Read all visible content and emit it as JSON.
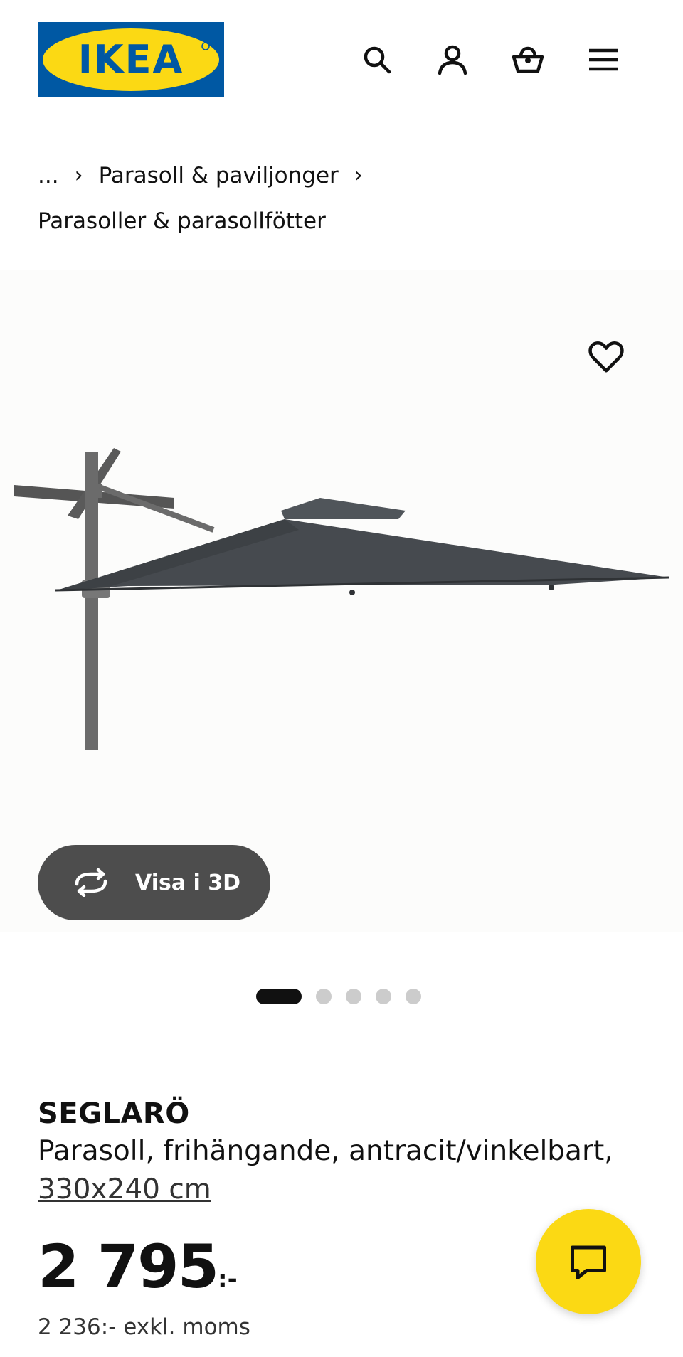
{
  "header": {
    "logo_text": "IKEA",
    "icons": [
      "search-icon",
      "profile-icon",
      "cart-icon",
      "menu-icon"
    ]
  },
  "breadcrumb": {
    "ellipsis": "...",
    "items": [
      "Parasoll & paviljonger",
      "Parasoller & parasollfötter"
    ],
    "separator": "›"
  },
  "media": {
    "view3d_label": "Visa i 3D",
    "dots_total": 5,
    "active_index": 0
  },
  "product": {
    "name": "SEGLARÖ",
    "description": "Parasoll, frihängande, antracit/vinkelbart,",
    "measure": "330x240 cm",
    "price": "2 795",
    "price_suffix": ":-",
    "ex_vat": "2 236:- exkl. moms"
  },
  "colors": {
    "brand_blue": "#0058a3",
    "brand_yellow": "#fbd914",
    "button_dark": "#4d4d4d"
  }
}
